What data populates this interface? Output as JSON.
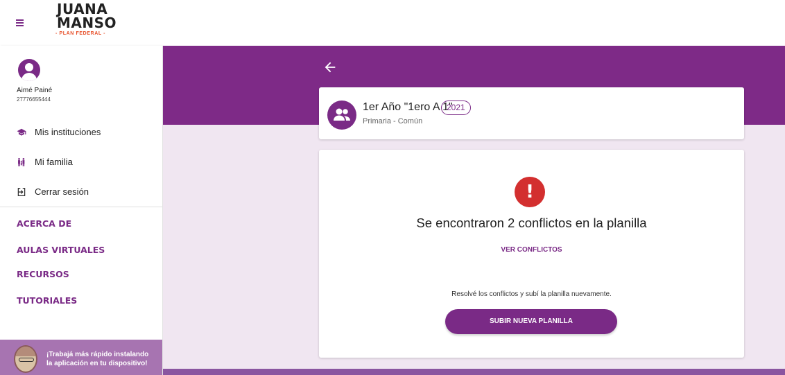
{
  "app": {
    "logo_line1": "JUANA",
    "logo_line2": "MANSO",
    "logo_sub": "- PLAN FEDERAL -"
  },
  "user": {
    "name": "Aimé Painé",
    "id": "27776655444"
  },
  "sidebar": {
    "items": [
      {
        "label": "Mis instituciones",
        "icon": "graduation-cap-icon"
      },
      {
        "label": "Mi familia",
        "icon": "family-icon"
      },
      {
        "label": "Cerrar sesión",
        "icon": "logout-icon"
      }
    ],
    "links": [
      "ACERCA DE",
      "AULAS VIRTUALES",
      "RECURSOS",
      "TUTORIALES"
    ],
    "promo": {
      "line1": "¡Trabajá más rápido instalando",
      "line2": "la aplicación en tu dispositivo!"
    }
  },
  "course": {
    "title": "1er Año \"1ero A 1\"",
    "year": "2021",
    "level": "Primaria - Común"
  },
  "conflict": {
    "message": "Se encontraron 2 conflictos en la planilla",
    "view_label": "VER CONFLICTOS",
    "hint": "Resolvé los conflictos y subí la planilla nuevamente.",
    "upload_label": "SUBIR NUEVA PLANILLA"
  },
  "colors": {
    "primary": "#7a2a86",
    "background": "#f0e6f1",
    "error": "#d32f2f"
  }
}
